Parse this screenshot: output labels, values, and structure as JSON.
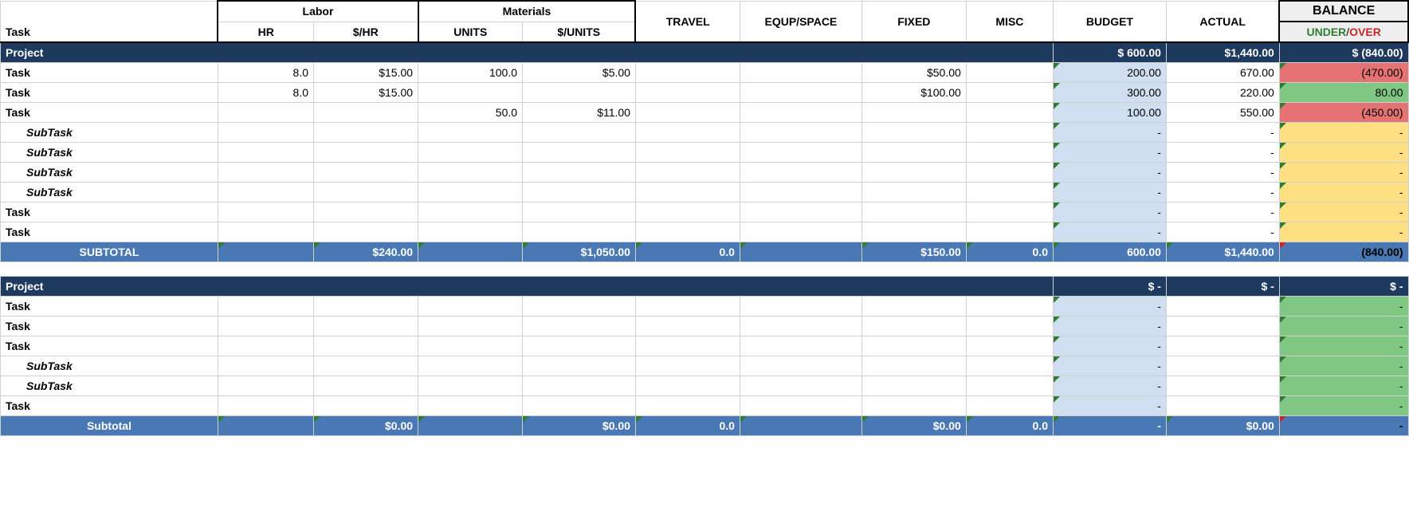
{
  "headers": {
    "task": "Task",
    "labor": "Labor",
    "hr": "HR",
    "perhr": "$/HR",
    "materials": "Materials",
    "units": "UNITS",
    "perunit": "$/UNITS",
    "travel": "TRAVEL",
    "equip": "EQUP/SPACE",
    "fixed": "FIXED",
    "misc": "MISC",
    "budget": "BUDGET",
    "actual": "ACTUAL",
    "balance": "BALANCE",
    "under": "UNDER",
    "sep": "/",
    "over": "OVER"
  },
  "p1": {
    "title": "Project",
    "budget": "$   600.00",
    "actual": "$1,440.00",
    "balance": "$     (840.00)",
    "rows": [
      {
        "cls": "c-task",
        "label": "Task",
        "hr": "8.0",
        "perhr": "$15.00",
        "units": "100.0",
        "perunit": "$5.00",
        "travel": "",
        "equip": "",
        "fixed": "$50.00",
        "misc": "",
        "budget": "200.00",
        "actual": "670.00",
        "bal": "(470.00)",
        "balcls": "bal-red"
      },
      {
        "cls": "c-task",
        "label": "Task",
        "hr": "8.0",
        "perhr": "$15.00",
        "units": "",
        "perunit": "",
        "travel": "",
        "equip": "",
        "fixed": "$100.00",
        "misc": "",
        "budget": "300.00",
        "actual": "220.00",
        "bal": "80.00",
        "balcls": "bal-green"
      },
      {
        "cls": "c-task",
        "label": "Task",
        "hr": "",
        "perhr": "",
        "units": "50.0",
        "perunit": "$11.00",
        "travel": "",
        "equip": "",
        "fixed": "",
        "misc": "",
        "budget": "100.00",
        "actual": "550.00",
        "bal": "(450.00)",
        "balcls": "bal-red"
      },
      {
        "cls": "c-sub",
        "label": "SubTask",
        "hr": "",
        "perhr": "",
        "units": "",
        "perunit": "",
        "travel": "",
        "equip": "",
        "fixed": "",
        "misc": "",
        "budget": "-",
        "actual": "-",
        "bal": "-",
        "balcls": "bal-yellow"
      },
      {
        "cls": "c-sub",
        "label": "SubTask",
        "hr": "",
        "perhr": "",
        "units": "",
        "perunit": "",
        "travel": "",
        "equip": "",
        "fixed": "",
        "misc": "",
        "budget": "-",
        "actual": "-",
        "bal": "-",
        "balcls": "bal-yellow"
      },
      {
        "cls": "c-sub",
        "label": "SubTask",
        "hr": "",
        "perhr": "",
        "units": "",
        "perunit": "",
        "travel": "",
        "equip": "",
        "fixed": "",
        "misc": "",
        "budget": "-",
        "actual": "-",
        "bal": "-",
        "balcls": "bal-yellow"
      },
      {
        "cls": "c-sub",
        "label": "SubTask",
        "hr": "",
        "perhr": "",
        "units": "",
        "perunit": "",
        "travel": "",
        "equip": "",
        "fixed": "",
        "misc": "",
        "budget": "-",
        "actual": "-",
        "bal": "-",
        "balcls": "bal-yellow"
      },
      {
        "cls": "c-task",
        "label": "Task",
        "hr": "",
        "perhr": "",
        "units": "",
        "perunit": "",
        "travel": "",
        "equip": "",
        "fixed": "",
        "misc": "",
        "budget": "-",
        "actual": "-",
        "bal": "-",
        "balcls": "bal-yellow"
      },
      {
        "cls": "c-task",
        "label": "Task",
        "hr": "",
        "perhr": "",
        "units": "",
        "perunit": "",
        "travel": "",
        "equip": "",
        "fixed": "",
        "misc": "",
        "budget": "-",
        "actual": "-",
        "bal": "-",
        "balcls": "bal-yellow"
      }
    ],
    "subtotal": {
      "label": "SUBTOTAL",
      "perhr": "$240.00",
      "perunit": "$1,050.00",
      "travel": "0.0",
      "fixed": "$150.00",
      "misc": "0.0",
      "budget": "600.00",
      "actual": "$1,440.00",
      "bal": "(840.00)"
    }
  },
  "p2": {
    "title": "Project",
    "budget": "$       -",
    "actual": "$       -",
    "balance": "$           -",
    "rows": [
      {
        "cls": "c-task",
        "label": "Task",
        "budget": "-",
        "bal": "-",
        "balcls": "bal-green"
      },
      {
        "cls": "c-task",
        "label": "Task",
        "budget": "-",
        "bal": "-",
        "balcls": "bal-green"
      },
      {
        "cls": "c-task",
        "label": "Task",
        "budget": "-",
        "bal": "-",
        "balcls": "bal-green"
      },
      {
        "cls": "c-sub",
        "label": "SubTask",
        "budget": "-",
        "bal": "-",
        "balcls": "bal-green"
      },
      {
        "cls": "c-sub",
        "label": "SubTask",
        "budget": "-",
        "bal": "-",
        "balcls": "bal-green"
      },
      {
        "cls": "c-task",
        "label": "Task",
        "budget": "-",
        "bal": "-",
        "balcls": "bal-green"
      }
    ],
    "subtotal": {
      "label": "Subtotal",
      "perhr": "$0.00",
      "perunit": "$0.00",
      "travel": "0.0",
      "fixed": "$0.00",
      "misc": "0.0",
      "budget": "-",
      "actual": "$0.00",
      "bal": "-"
    }
  }
}
